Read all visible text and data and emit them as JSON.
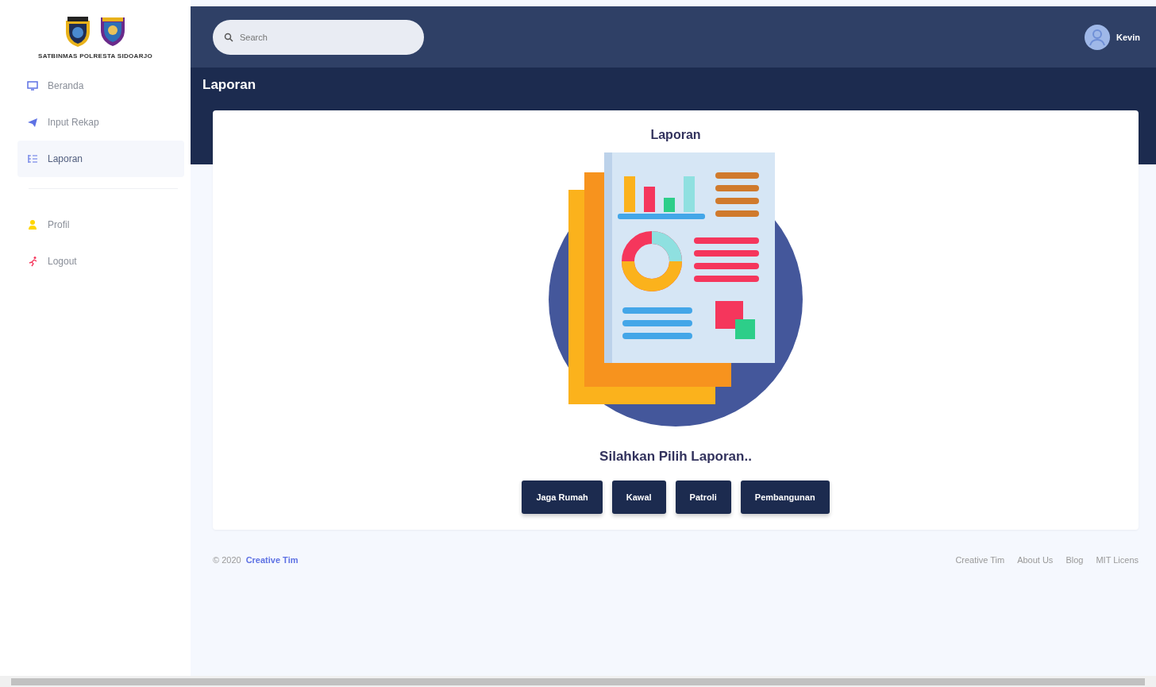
{
  "sidebar": {
    "logo_caption": "SATBINMAS POLRESTA SIDOARJO",
    "sections": [
      {
        "items": [
          {
            "label": "Beranda",
            "selected": false
          },
          {
            "label": "Input Rekap",
            "selected": false
          },
          {
            "label": "Laporan",
            "selected": true
          }
        ]
      },
      {
        "items": [
          {
            "label": "Profil",
            "selected": false
          },
          {
            "label": "Logout",
            "selected": false
          }
        ]
      }
    ]
  },
  "navbar": {
    "search": {
      "placeholder": "Search"
    },
    "user": {
      "name": "Kevin"
    }
  },
  "header": {
    "title": "Laporan"
  },
  "card": {
    "title": "Laporan",
    "prompt": "Silahkan Pilih Laporan..",
    "buttons": [
      "Jaga Rumah",
      "Kawal",
      "Patroli",
      "Pembangunan"
    ]
  },
  "footer": {
    "copyright": "© 2020",
    "brand": "Creative Tim",
    "links": [
      "Creative Tim",
      "About Us",
      "Blog",
      "MIT Licens"
    ]
  }
}
